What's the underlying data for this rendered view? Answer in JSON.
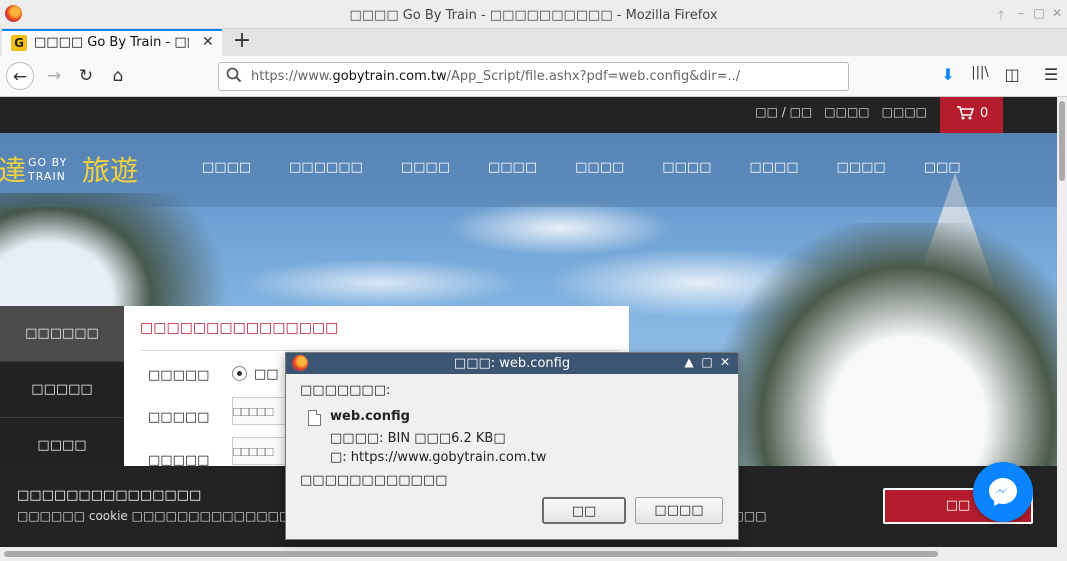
{
  "window": {
    "title": "□□□□ Go By Train - □□□□□□□□□□ - Mozilla Firefox",
    "controls": {
      "up": "🡑",
      "minimize": "–",
      "maximize": "□",
      "close": "✕"
    }
  },
  "tab": {
    "title": "□□□□ Go By Train - □□",
    "favicon_letter": "G",
    "close": "✕",
    "new_tab": "+"
  },
  "nav": {
    "back": "←",
    "forward": "→",
    "reload": "↻",
    "home": "⌂",
    "url_prefix": "https://www.",
    "url_host": "gobytrain.com.tw",
    "url_path": "/App_Script/file.ashx?pdf=web.config&dir=../",
    "search_icon": "search-icon",
    "download": "⬇",
    "library": "|||\\",
    "sidebar": "◫",
    "menu": "☰"
  },
  "site": {
    "top_links": [
      "□□ / □□",
      "□□□□",
      "□□□□"
    ],
    "cart_icon": "🛒",
    "cart_count": "0",
    "logo_cn1": "達",
    "logo_en_1": "GO BY",
    "logo_en_2": "TRAIN",
    "logo_cn2": "旅遊",
    "main_nav": [
      "□□□□",
      "□□□□□□",
      "□□□□",
      "□□□□",
      "□□□□",
      "□□□□",
      "□□□□",
      "□□□□",
      "□□□"
    ],
    "side_nav": [
      "□□□□□□",
      "□□□□□",
      "□□□□"
    ],
    "form_title": "□□□□□□□□□□□□□□□",
    "form_labels": [
      "□□□□□",
      "□□□□□",
      "□□□□□"
    ],
    "radio_label": "□□",
    "input_placeholder": "□□□□□",
    "cookie_title": "□□□□□□□□□□□□□□□",
    "cookie_text": "□□□□□□ cookie □□□□□□□□□□□□□□□□□□□□□□□□□□□□□□□□□□□□□□□□□□□□□□□□□□□□□□□□",
    "cookie_accept": "□□"
  },
  "dialog": {
    "title": "□□□: web.config",
    "prompt": "□□□□□□□:",
    "file_name": "web.config",
    "file_type": "□□□□: BIN □□□6.2 KB□",
    "file_from": "□: https://www.gobytrain.com.tw",
    "question": "□□□□□□□□□□□□",
    "ok_label": "□□",
    "cancel_label": "□□□□",
    "controls": {
      "up": "▲",
      "maximize": "□",
      "close": "✕"
    }
  },
  "colors": {
    "brand_red": "#b51c2c",
    "firefox_blue": "#0a84ff",
    "dialog_title": "#3c5573"
  }
}
